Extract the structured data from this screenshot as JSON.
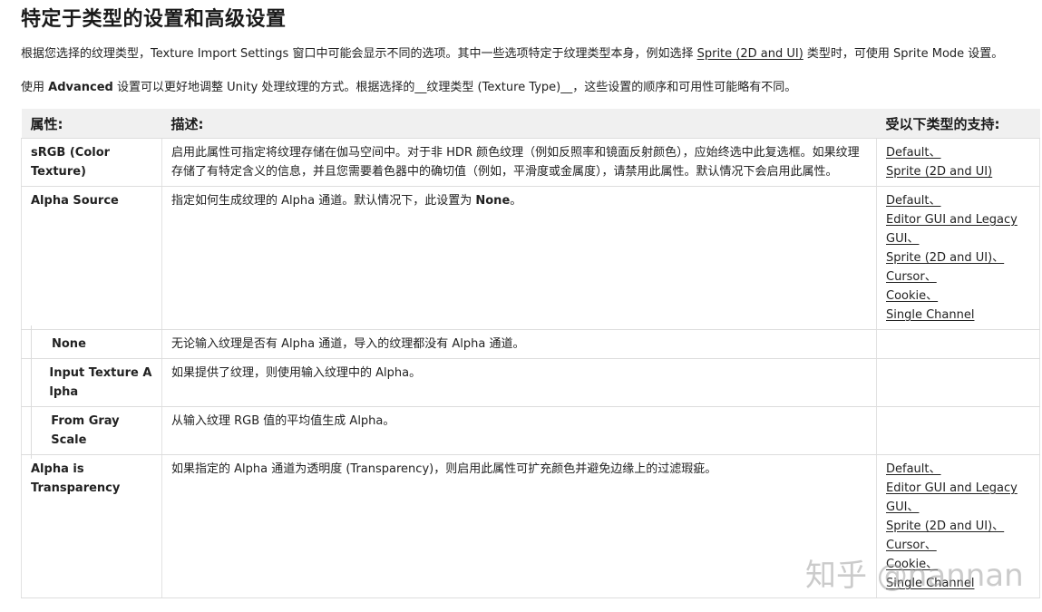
{
  "title": "特定于类型的设置和高级设置",
  "para1": {
    "before": "根据您选择的纹理类型，Texture Import Settings 窗口中可能会显示不同的选项。其中一些选项特定于纹理类型本身，例如选择 ",
    "link": "Sprite (2D and UI)",
    "after": " 类型时，可使用 Sprite Mode 设置。"
  },
  "para2": {
    "before": "使用 ",
    "bold": "Advanced",
    "after": " 设置可以更好地调整 Unity 处理纹理的方式。根据选择的__纹理类型 (Texture Type)__，这些设置的顺序和可用性可能略有不同。"
  },
  "table": {
    "headers": {
      "property": "属性:",
      "description": "描述:",
      "support": "受以下类型的支持:"
    },
    "rows": [
      {
        "property": "sRGB (Color Texture)",
        "description": "启用此属性可指定将纹理存储在伽马空间中。对于非 HDR 颜色纹理（例如反照率和镜面反射颜色），应始终选中此复选框。如果纹理存储了有特定含义的信息，并且您需要着色器中的确切值（例如，平滑度或金属度），请禁用此属性。默认情况下会启用此属性。",
        "support": [
          "Default、",
          "Sprite (2D and UI)"
        ]
      },
      {
        "property": "Alpha Source",
        "description_before": "指定如何生成纹理的 Alpha 通道。默认情况下，此设置为 ",
        "description_bold": "None",
        "description_after": "。",
        "support": [
          "Default、",
          "Editor GUI and Legacy GUI、",
          "Sprite (2D and UI)、",
          "Cursor、",
          "Cookie、",
          "Single Channel"
        ]
      },
      {
        "property": "None",
        "description": "无论输入纹理是否有 Alpha 通道，导入的纹理都没有 Alpha 通道。"
      },
      {
        "property": "Input Texture Alpha",
        "description": "如果提供了纹理，则使用输入纹理中的 Alpha。"
      },
      {
        "property": "From Gray Scale",
        "description": "从输入纹理 RGB 值的平均值生成 Alpha。"
      },
      {
        "property": "Alpha is Transparency",
        "description": "如果指定的 Alpha 通道为透明度 (Transparency)，则启用此属性可扩充颜色并避免边缘上的过滤瑕疵。",
        "support": [
          "Default、",
          "Editor GUI and Legacy GUI、",
          "Sprite (2D and UI)、",
          "Cursor、",
          "Cookie、",
          "Single Channel"
        ]
      }
    ]
  },
  "watermark": "知乎 @nannan"
}
